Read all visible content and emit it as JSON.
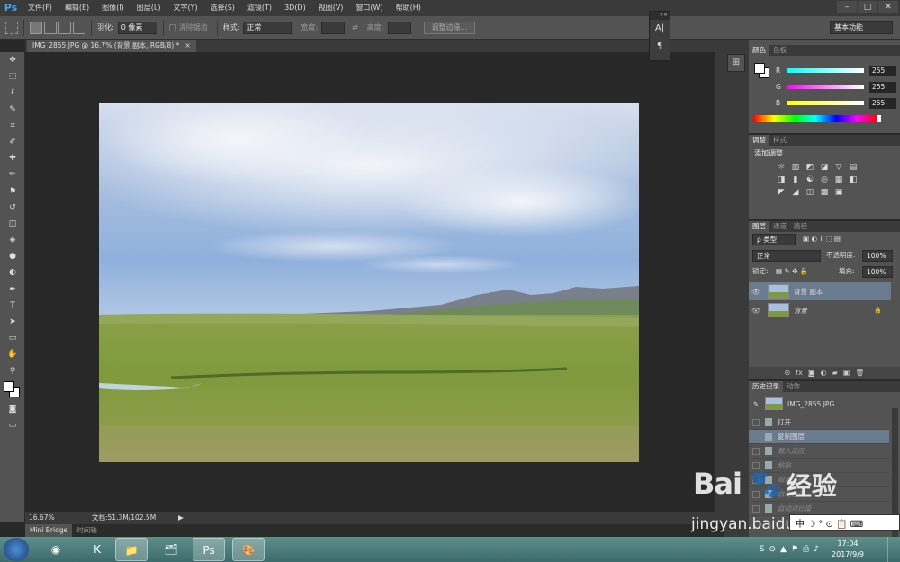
{
  "menubar": {
    "logo": "Ps",
    "items": [
      "文件(F)",
      "编辑(E)",
      "图像(I)",
      "图层(L)",
      "文字(Y)",
      "选择(S)",
      "滤镜(T)",
      "3D(D)",
      "视图(V)",
      "窗口(W)",
      "帮助(H)"
    ],
    "window_buttons": [
      "–",
      "□",
      "✕"
    ]
  },
  "options": {
    "feather_label": "羽化:",
    "feather_value": "0 像素",
    "antialias_label": "消除锯齿",
    "style_label": "样式:",
    "style_value": "正常",
    "width_label": "宽度:",
    "height_label": "高度:",
    "refine_edge_button": "调整边缘...",
    "workspace": "基本功能"
  },
  "float_panel": {
    "icon1": "A|",
    "icon2": "¶"
  },
  "tools": [
    "move-tool",
    "marquee-tool",
    "lasso-tool",
    "quick-select-tool",
    "crop-tool",
    "eyedropper-tool",
    "healing-brush-tool",
    "brush-tool",
    "clone-stamp-tool",
    "history-brush-tool",
    "eraser-tool",
    "paint-bucket-tool",
    "blur-tool",
    "dodge-tool",
    "pen-tool",
    "type-tool",
    "path-select-tool",
    "shape-tool",
    "hand-tool",
    "zoom-tool"
  ],
  "tool_glyphs": [
    "✥",
    "⬚",
    "ℓ",
    "✎",
    "⌗",
    "✐",
    "✚",
    "✏",
    "⚑",
    "↺",
    "◫",
    "◈",
    "●",
    "◐",
    "✒",
    "T",
    "➤",
    "▭",
    "✋",
    "⚲"
  ],
  "document": {
    "tab_title": "IMG_2855.JPG @ 16.7% (背景 副本, RGB/8) *",
    "close": "×"
  },
  "status": {
    "zoom": "16.67%",
    "doc_size": "文档:51.3M/102.5M",
    "arrow": "▶"
  },
  "bottom_tabs": [
    "Mini Bridge",
    "时间轴"
  ],
  "color_panel": {
    "tabs": [
      "颜色",
      "色板"
    ],
    "channels": [
      {
        "label": "R",
        "value": "255",
        "gradient": "linear-gradient(to right, #00ffff, #ffffff)"
      },
      {
        "label": "G",
        "value": "255",
        "gradient": "linear-gradient(to right, #ff00ff, #ffffff)"
      },
      {
        "label": "B",
        "value": "255",
        "gradient": "linear-gradient(to right, #ffff00, #ffffff)"
      }
    ]
  },
  "adjust_panel": {
    "tabs": [
      "调整",
      "样式"
    ],
    "title": "添加调整",
    "icons": [
      "☼",
      "▥",
      "◩",
      "◪",
      "▽",
      "▤",
      "◨",
      "▮",
      "☯",
      "◎",
      "▦",
      "◧",
      "◤",
      "◢",
      "◫",
      "▩",
      "▣"
    ]
  },
  "layers_panel": {
    "tabs": [
      "图层",
      "通道",
      "路径"
    ],
    "kind": "ρ 类型",
    "blend_mode": "正常",
    "opacity_label": "不透明度:",
    "opacity_value": "100%",
    "lock_label": "锁定:",
    "fill_label": "填充:",
    "fill_value": "100%",
    "layers": [
      {
        "name": "背景 副本",
        "selected": true
      },
      {
        "name": "背景",
        "selected": false,
        "lock": "🔒"
      }
    ],
    "footer_icons": [
      "⊝",
      "fx",
      "◙",
      "◐",
      "▰",
      "▣",
      "🗑"
    ]
  },
  "history_panel": {
    "tabs": [
      "历史记录",
      "动作"
    ],
    "snapshot": "IMG_2855.JPG",
    "steps": [
      {
        "label": "打开",
        "state": "normal"
      },
      {
        "label": "复制图层",
        "state": "selected"
      },
      {
        "label": "载入选区",
        "state": "undone"
      },
      {
        "label": "粘贴",
        "state": "undone"
      },
      {
        "label": "取消选择",
        "state": "undone"
      },
      {
        "label": "自动色调",
        "state": "undone"
      },
      {
        "label": "自动对比度",
        "state": "undone"
      }
    ]
  },
  "watermark": {
    "brand": "Bai",
    "brand_suffix": "经验",
    "url": "jingyan.baidu.com"
  },
  "ime": {
    "text": "中 ☽ ° ⊙ 📋 ⌨"
  },
  "taskbar": {
    "apps": [
      {
        "name": "chrome",
        "glyph": "◉",
        "open": false
      },
      {
        "name": "kugou",
        "glyph": "K",
        "open": false
      },
      {
        "name": "explorer",
        "glyph": "📁",
        "open": true
      },
      {
        "name": "folder",
        "glyph": "🗂",
        "open": false
      },
      {
        "name": "photoshop",
        "glyph": "Ps",
        "open": true
      },
      {
        "name": "paint",
        "glyph": "🎨",
        "open": true
      }
    ],
    "tray_icons": [
      "S",
      "⊙",
      "▲",
      "⚑",
      "⎙",
      "♪"
    ],
    "time": "17:04",
    "date": "2017/9/9"
  }
}
